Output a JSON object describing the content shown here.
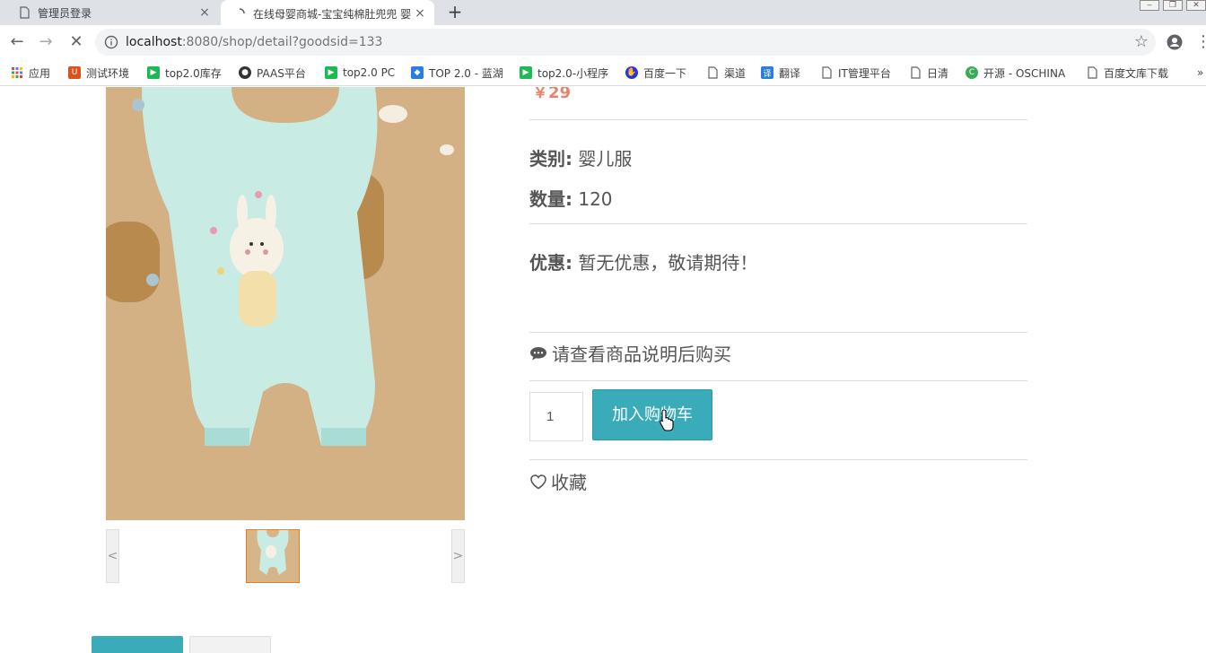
{
  "browser": {
    "tabs": [
      {
        "title": "管理员登录",
        "active": false
      },
      {
        "title": "在线母婴商城-宝宝纯棉肚兜兜 婴",
        "active": true
      }
    ],
    "new_tab": "+",
    "close": "×",
    "url_host": "localhost",
    "url_rest": ":8080/shop/detail?goodsid=133"
  },
  "bookmarks": [
    {
      "label": "应用",
      "icon": "apps-grid-icon",
      "color": "#e8453c"
    },
    {
      "label": "测试环境",
      "icon": "u-logo-icon",
      "color": "#d9531e"
    },
    {
      "label": "top2.0库存",
      "icon": "play-icon",
      "color": "#1db954"
    },
    {
      "label": "PAAS平台",
      "icon": "panda-icon",
      "color": "#333333"
    },
    {
      "label": "top2.0 PC",
      "icon": "play-icon",
      "color": "#1db954"
    },
    {
      "label": "TOP 2.0 - 蓝湖",
      "icon": "lanhu-icon",
      "color": "#2a7de1"
    },
    {
      "label": "top2.0-小程序",
      "icon": "play-icon",
      "color": "#1db954"
    },
    {
      "label": "百度一下",
      "icon": "baidu-paw-icon",
      "color": "#2932e1"
    },
    {
      "label": "渠道",
      "icon": "page-icon",
      "color": "#5f6368"
    },
    {
      "label": "翻译",
      "icon": "translate-icon",
      "color": "#2a7de1"
    },
    {
      "label": "IT管理平台",
      "icon": "page-icon",
      "color": "#5f6368"
    },
    {
      "label": "日清",
      "icon": "page-icon",
      "color": "#5f6368"
    },
    {
      "label": "开源 - OSCHINA",
      "icon": "oschina-icon",
      "color": "#3bab5a"
    },
    {
      "label": "百度文库下载",
      "icon": "page-icon",
      "color": "#5f6368"
    }
  ],
  "bookmarks_more": "»",
  "product": {
    "price": "￥29",
    "category_label": "类别:",
    "category_value": " 婴儿服",
    "quantity_label": "数量:",
    "quantity_value": " 120",
    "discount_label": "优惠:",
    "discount_value": " 暂无优惠，敬请期待！",
    "notice": "请查看商品说明后购买",
    "qty_input": "1",
    "add_to_cart": "加入购物车",
    "favorite": "收藏",
    "carousel_prev": "<",
    "carousel_next": ">"
  },
  "colors": {
    "accent": "#3aabb8",
    "price": "#e9846b",
    "thumb_border": "#e67e22"
  }
}
